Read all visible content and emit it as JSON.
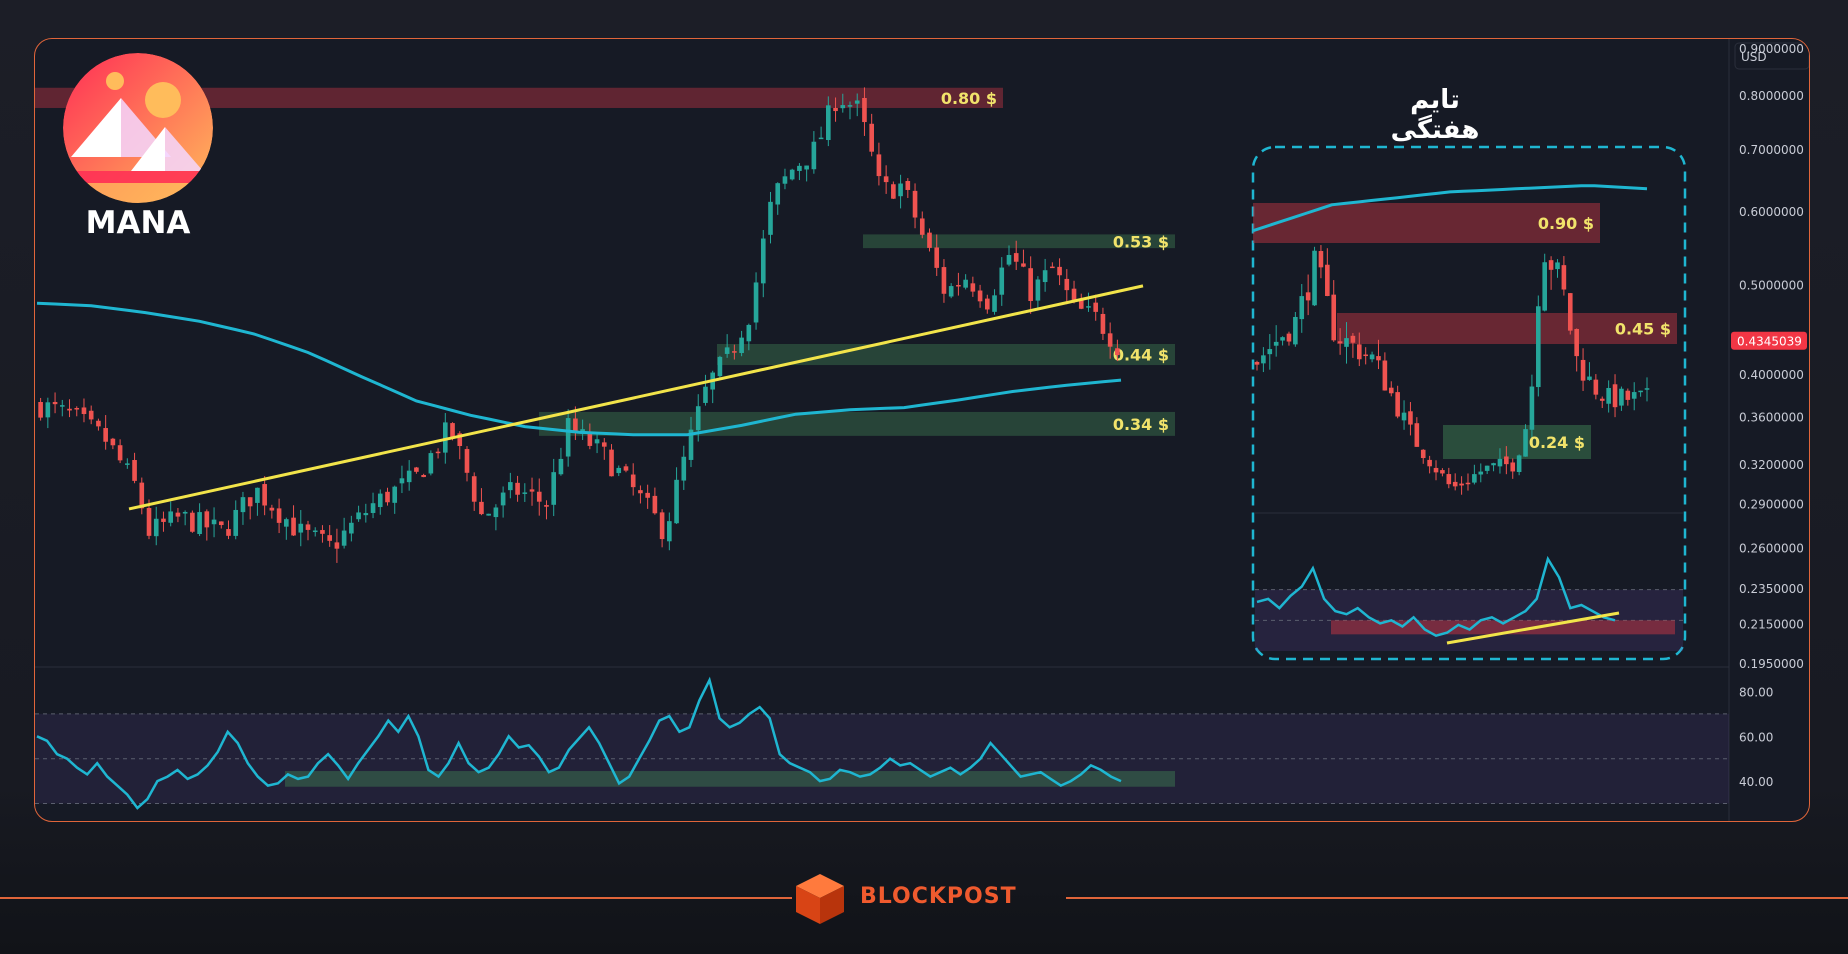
{
  "asset": {
    "ticker": "MANA"
  },
  "weekly_panel": {
    "title": "تایم هفتگی"
  },
  "brand": {
    "name": "BLOCKPOST"
  },
  "colors": {
    "frame": "#e0653a",
    "background": "#161a25",
    "up_candle": "#26a69a",
    "down_candle": "#ef5350",
    "ema": "#1fb6d1",
    "trendline": "#f2e44a",
    "zone_label": "#f1e36b",
    "price_badge": "#f23645"
  },
  "chart_data": [
    {
      "type": "candlestick",
      "scale": "log",
      "currency_label": "USD",
      "ylim": [
        0.195,
        0.92
      ],
      "y_ticks": [
        {
          "value": 0.9,
          "label": "0.9000000"
        },
        {
          "value": 0.8,
          "label": "0.8000000"
        },
        {
          "value": 0.7,
          "label": "0.7000000"
        },
        {
          "value": 0.6,
          "label": "0.6000000"
        },
        {
          "value": 0.5,
          "label": "0.5000000"
        },
        {
          "value": 0.4,
          "label": "0.4000000"
        },
        {
          "value": 0.36,
          "label": "0.3600000"
        },
        {
          "value": 0.32,
          "label": "0.3200000"
        },
        {
          "value": 0.29,
          "label": "0.2900000"
        },
        {
          "value": 0.26,
          "label": "0.2600000"
        },
        {
          "value": 0.235,
          "label": "0.2350000"
        },
        {
          "value": 0.215,
          "label": "0.2150000"
        },
        {
          "value": 0.195,
          "label": "0.1950000"
        }
      ],
      "last_price": {
        "value": 0.4345039,
        "label": "0.4345039"
      },
      "zones": [
        {
          "kind": "resistance",
          "low": 0.775,
          "high": 0.815,
          "label": "0.80 $"
        },
        {
          "kind": "support",
          "low": 0.547,
          "high": 0.566,
          "label": "0.53 $"
        },
        {
          "kind": "support",
          "low": 0.409,
          "high": 0.431,
          "label": "0.44 $"
        },
        {
          "kind": "support",
          "low": 0.343,
          "high": 0.364,
          "label": "0.34 $"
        }
      ],
      "trendline": {
        "start": 0.286,
        "end": 0.498
      },
      "ema_path": [
        [
          0,
          0.477
        ],
        [
          0.05,
          0.474
        ],
        [
          0.1,
          0.466
        ],
        [
          0.15,
          0.456
        ],
        [
          0.2,
          0.442
        ],
        [
          0.25,
          0.422
        ],
        [
          0.3,
          0.397
        ],
        [
          0.35,
          0.374
        ],
        [
          0.4,
          0.361
        ],
        [
          0.45,
          0.351
        ],
        [
          0.5,
          0.346
        ],
        [
          0.55,
          0.344
        ],
        [
          0.6,
          0.344
        ],
        [
          0.65,
          0.352
        ],
        [
          0.7,
          0.362
        ],
        [
          0.75,
          0.366
        ],
        [
          0.8,
          0.368
        ],
        [
          0.85,
          0.375
        ],
        [
          0.9,
          0.383
        ],
        [
          0.95,
          0.389
        ],
        [
          1,
          0.394
        ]
      ],
      "price_path": [
        [
          0,
          0.37
        ],
        [
          0.03,
          0.36
        ],
        [
          0.06,
          0.34
        ],
        [
          0.09,
          0.3
        ],
        [
          0.1,
          0.27
        ],
        [
          0.13,
          0.28
        ],
        [
          0.17,
          0.27
        ],
        [
          0.2,
          0.3
        ],
        [
          0.24,
          0.27
        ],
        [
          0.27,
          0.26
        ],
        [
          0.31,
          0.29
        ],
        [
          0.35,
          0.31
        ],
        [
          0.38,
          0.35
        ],
        [
          0.41,
          0.28
        ],
        [
          0.44,
          0.3
        ],
        [
          0.47,
          0.29
        ],
        [
          0.49,
          0.35
        ],
        [
          0.52,
          0.33
        ],
        [
          0.55,
          0.3
        ],
        [
          0.58,
          0.27
        ],
        [
          0.6,
          0.33
        ],
        [
          0.62,
          0.39
        ],
        [
          0.64,
          0.42
        ],
        [
          0.66,
          0.47
        ],
        [
          0.68,
          0.62
        ],
        [
          0.7,
          0.67
        ],
        [
          0.72,
          0.7
        ],
        [
          0.74,
          0.8
        ],
        [
          0.76,
          0.77
        ],
        [
          0.78,
          0.63
        ],
        [
          0.8,
          0.64
        ],
        [
          0.82,
          0.56
        ],
        [
          0.84,
          0.49
        ],
        [
          0.86,
          0.51
        ],
        [
          0.88,
          0.48
        ],
        [
          0.9,
          0.54
        ],
        [
          0.92,
          0.49
        ],
        [
          0.94,
          0.52
        ],
        [
          0.96,
          0.47
        ],
        [
          0.98,
          0.46
        ],
        [
          1,
          0.43
        ]
      ]
    },
    {
      "type": "line",
      "indicator": "RSI",
      "ylim": [
        24,
        90
      ],
      "y_ticks": [
        {
          "value": 80,
          "label": "80.00"
        },
        {
          "value": 60,
          "label": "60.00"
        },
        {
          "value": 40,
          "label": "40.00"
        }
      ],
      "bands": [
        70,
        50,
        30
      ],
      "support_zone": [
        37.5,
        44.5
      ],
      "values": [
        60,
        58,
        52,
        50,
        46,
        43,
        48,
        42,
        38,
        34,
        28,
        32,
        40,
        42,
        45,
        41,
        43,
        47,
        53,
        62,
        57,
        48,
        42,
        38,
        39,
        43,
        41,
        42,
        48,
        52,
        47,
        41,
        48,
        54,
        60,
        67,
        62,
        69,
        60,
        45,
        42,
        48,
        57,
        48,
        44,
        46,
        52,
        60,
        55,
        56,
        51,
        44,
        46,
        54,
        59,
        64,
        57,
        48,
        39,
        42,
        50,
        58,
        67,
        69,
        62,
        64,
        76,
        85,
        68,
        64,
        66,
        70,
        73,
        68,
        52,
        48,
        46,
        44,
        40,
        41,
        45,
        44,
        42,
        43,
        46,
        50,
        47,
        48,
        45,
        42,
        44,
        46,
        43,
        46,
        50,
        57,
        52,
        47,
        42,
        43,
        44,
        41,
        38,
        40,
        43,
        47,
        45,
        42,
        40
      ]
    },
    {
      "type": "candlestick",
      "title": "تایم هفتگی",
      "zones": [
        {
          "kind": "resistance",
          "label": "0.90 $"
        },
        {
          "kind": "resistance",
          "label": "0.45 $"
        },
        {
          "kind": "support",
          "label": "0.24 $"
        }
      ],
      "price_path": [
        [
          0,
          0.5
        ],
        [
          0.1,
          0.56
        ],
        [
          0.15,
          0.65
        ],
        [
          0.2,
          0.54
        ],
        [
          0.3,
          0.5
        ],
        [
          0.4,
          0.38
        ],
        [
          0.5,
          0.3
        ],
        [
          0.58,
          0.33
        ],
        [
          0.66,
          0.34
        ],
        [
          0.7,
          0.42
        ],
        [
          0.73,
          0.68
        ],
        [
          0.78,
          0.62
        ],
        [
          0.82,
          0.5
        ],
        [
          0.86,
          0.46
        ],
        [
          0.9,
          0.44
        ]
      ],
      "ema_path": [
        [
          0,
          0.7
        ],
        [
          0.2,
          0.74
        ],
        [
          0.5,
          0.76
        ],
        [
          0.85,
          0.77
        ],
        [
          1,
          0.765
        ]
      ],
      "rsi_values": [
        62,
        64,
        58,
        66,
        72,
        84,
        64,
        56,
        54,
        58,
        52,
        48,
        50,
        46,
        52,
        44,
        40,
        42,
        47,
        44,
        50,
        52,
        48,
        52,
        56,
        64,
        90,
        78,
        58,
        60,
        56,
        52,
        50
      ]
    }
  ]
}
